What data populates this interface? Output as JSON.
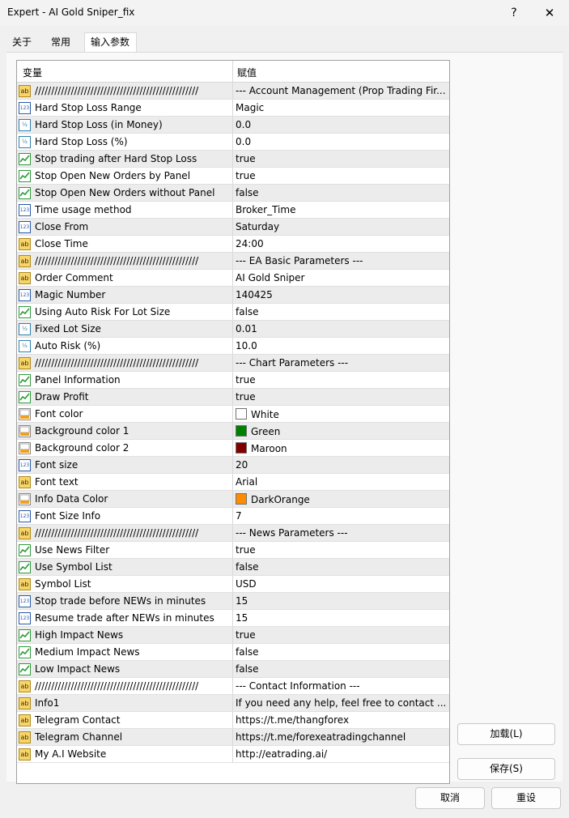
{
  "window": {
    "title": "Expert - AI Gold Sniper_fix"
  },
  "tabs": [
    {
      "label": "关于"
    },
    {
      "label": "常用"
    },
    {
      "label": "输入参数"
    }
  ],
  "grid": {
    "header": {
      "variable": "变量",
      "value": "赋值"
    },
    "rows": [
      {
        "icon": "ab",
        "name": "//////////////////////////////////////////////////",
        "value": "--- Account Management (Prop Trading Fir..."
      },
      {
        "icon": "123",
        "name": "Hard Stop Loss Range",
        "value": "Magic"
      },
      {
        "icon": "frac",
        "name": "Hard Stop Loss (in Money)",
        "value": "0.0"
      },
      {
        "icon": "frac",
        "name": "Hard Stop Loss (%)",
        "value": "0.0"
      },
      {
        "icon": "bool",
        "name": "Stop trading after Hard Stop Loss",
        "value": "true"
      },
      {
        "icon": "bool",
        "name": "Stop Open New Orders by Panel",
        "value": "true"
      },
      {
        "icon": "bool",
        "name": "Stop Open New Orders without Panel",
        "value": "false"
      },
      {
        "icon": "123",
        "name": "Time usage method",
        "value": "Broker_Time"
      },
      {
        "icon": "123",
        "name": "Close From",
        "value": "Saturday"
      },
      {
        "icon": "ab",
        "name": "Close Time",
        "value": "24:00"
      },
      {
        "icon": "ab",
        "name": "//////////////////////////////////////////////////",
        "value": "--- EA Basic Parameters ---"
      },
      {
        "icon": "ab",
        "name": "Order Comment",
        "value": "AI Gold Sniper"
      },
      {
        "icon": "123",
        "name": "Magic Number",
        "value": "140425"
      },
      {
        "icon": "bool",
        "name": "Using Auto Risk For Lot Size",
        "value": "false"
      },
      {
        "icon": "frac",
        "name": "Fixed Lot Size",
        "value": "0.01"
      },
      {
        "icon": "frac",
        "name": "Auto Risk (%)",
        "value": "10.0"
      },
      {
        "icon": "ab",
        "name": "//////////////////////////////////////////////////",
        "value": "--- Chart Parameters ---"
      },
      {
        "icon": "bool",
        "name": "Panel Information",
        "value": "true"
      },
      {
        "icon": "bool",
        "name": "Draw Profit",
        "value": "true"
      },
      {
        "icon": "color",
        "name": "Font color",
        "value": "White",
        "swatch": "#ffffff"
      },
      {
        "icon": "color",
        "name": "Background color 1",
        "value": "Green",
        "swatch": "#008000"
      },
      {
        "icon": "color",
        "name": "Background color 2",
        "value": "Maroon",
        "swatch": "#800000"
      },
      {
        "icon": "123",
        "name": "Font size",
        "value": "20"
      },
      {
        "icon": "ab",
        "name": "Font text",
        "value": "Arial"
      },
      {
        "icon": "color",
        "name": "Info Data Color",
        "value": "DarkOrange",
        "swatch": "#ff8c00"
      },
      {
        "icon": "123",
        "name": "Font Size Info",
        "value": "7"
      },
      {
        "icon": "ab",
        "name": "//////////////////////////////////////////////////",
        "value": "--- News Parameters ---"
      },
      {
        "icon": "bool",
        "name": "Use News Filter",
        "value": "true"
      },
      {
        "icon": "bool",
        "name": "Use Symbol List",
        "value": "false"
      },
      {
        "icon": "ab",
        "name": "Symbol List",
        "value": "USD"
      },
      {
        "icon": "123",
        "name": "Stop trade before NEWs in minutes",
        "value": "15"
      },
      {
        "icon": "123",
        "name": "Resume trade after NEWs in minutes",
        "value": "15"
      },
      {
        "icon": "bool",
        "name": "High Impact News",
        "value": "true"
      },
      {
        "icon": "bool",
        "name": "Medium Impact News",
        "value": "false"
      },
      {
        "icon": "bool",
        "name": "Low Impact News",
        "value": "false"
      },
      {
        "icon": "ab",
        "name": "//////////////////////////////////////////////////",
        "value": "--- Contact Information ---"
      },
      {
        "icon": "ab",
        "name": "Info1",
        "value": "If you need any help, feel free to contact ..."
      },
      {
        "icon": "ab",
        "name": "Telegram Contact",
        "value": "https://t.me/thangforex"
      },
      {
        "icon": "ab",
        "name": "Telegram Channel",
        "value": "https://t.me/forexeatradingchannel"
      },
      {
        "icon": "ab",
        "name": "My A.I Website",
        "value": "http://eatrading.ai/"
      }
    ]
  },
  "buttons": {
    "load": "加载(L)",
    "save": "保存(S)",
    "cancel": "取消",
    "reset": "重设"
  },
  "icons": {
    "ab": "string-type-icon",
    "123": "integer-type-icon",
    "frac": "double-type-icon",
    "bool": "bool-type-icon",
    "color": "color-type-icon"
  }
}
